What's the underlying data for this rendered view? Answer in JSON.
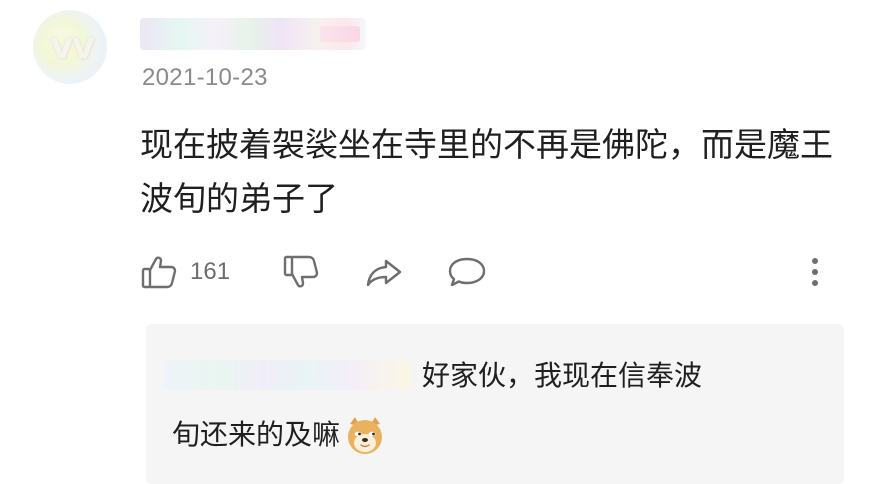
{
  "comment": {
    "author_name": "",
    "date": "2021-10-23",
    "text": "现在披着袈裟坐在寺里的不再是佛陀，而是魔王波旬的弟子了",
    "actions": {
      "like_count": "161",
      "like_icon": "thumbs-up-icon",
      "dislike_icon": "thumbs-down-icon",
      "share_icon": "share-arrow-icon",
      "reply_icon": "speech-bubble-icon",
      "more_icon": "vertical-ellipsis-icon"
    }
  },
  "reply": {
    "author_name": "",
    "text_line1": "好家伙，我现在信奉波",
    "text_line2": "旬还来的及嘛",
    "emoji": "doge-emoji"
  },
  "colors": {
    "text": "#1f1f1f",
    "muted": "#8a8a8a",
    "icon": "#6e6e6e",
    "reply_bg": "#f5f5f5"
  }
}
